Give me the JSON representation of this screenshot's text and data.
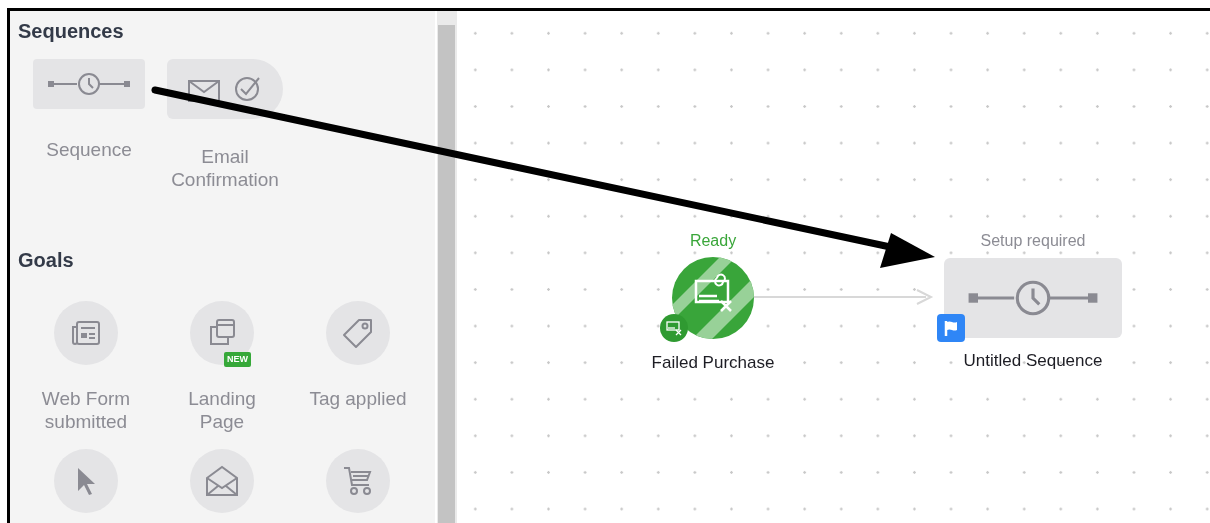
{
  "sidebar": {
    "sections": [
      {
        "title": "Sequences",
        "kind": "tiles",
        "items": [
          {
            "label": "Sequence",
            "kind": "sequence"
          },
          {
            "label": "Email Confirmation",
            "kind": "email-confirmation"
          }
        ]
      },
      {
        "title": "Goals",
        "kind": "circles",
        "items": [
          {
            "label": "Web Form submitted",
            "kind": "web-form"
          },
          {
            "label": "Landing Page",
            "kind": "landing-page",
            "badge": "NEW"
          },
          {
            "label": "Tag applied",
            "kind": "tag"
          },
          {
            "kind": "click"
          },
          {
            "kind": "email-open"
          },
          {
            "kind": "cart"
          }
        ]
      }
    ]
  },
  "canvas": {
    "nodes": [
      {
        "kind": "trigger",
        "status": "Ready",
        "ready": true,
        "label": "Failed Purchase"
      },
      {
        "kind": "sequence",
        "status": "Setup required",
        "ready": false,
        "label": "Untitled Sequence",
        "flagged": true
      }
    ]
  }
}
